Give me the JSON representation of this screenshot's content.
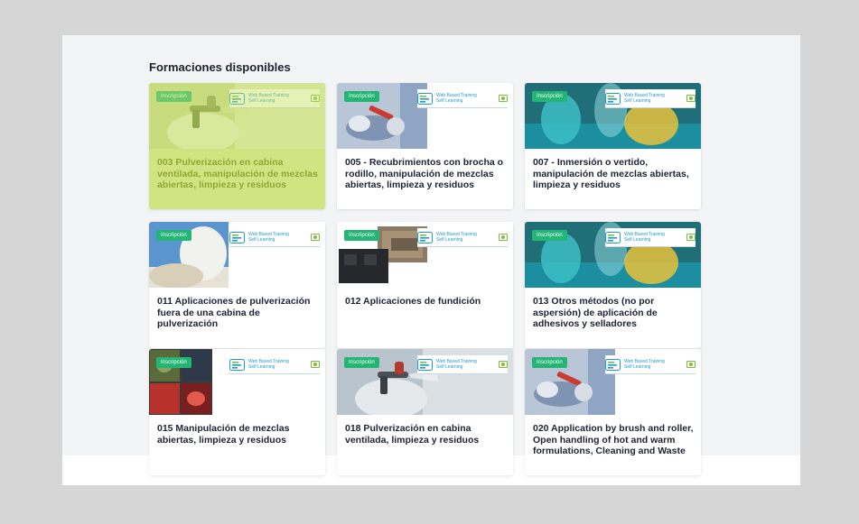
{
  "page": {
    "title": "Formaciones disponibles"
  },
  "badge_label": "Inscripción",
  "brand": {
    "line1": "Web Based Training",
    "line2": "Self Learning"
  },
  "courses": [
    {
      "title": "003 Pulverización en cabina ventilada, manipulación de mezclas abiertas, limpieza y residuos",
      "selected": true
    },
    {
      "title": "005 - Recubrimientos con brocha o rodillo, manipulación de mezclas abiertas, limpieza y residuos"
    },
    {
      "title": "007 - Inmersión o vertido, manipulación de mezclas abiertas, limpieza y residuos"
    },
    {
      "title": "011 Aplicaciones de pulverización fuera de una cabina de pulverización"
    },
    {
      "title": "012 Aplicaciones de fundición"
    },
    {
      "title": "013 Otros métodos (no por aspersión) de aplicación de adhesivos y selladores"
    },
    {
      "title": "015 Manipulación de mezclas abiertas, limpieza y residuos"
    },
    {
      "title": "018 Pulverización en cabina ventilada, limpieza y residuos"
    },
    {
      "title": "020 Application by brush and roller, Open handling of hot and warm formulations, Cleaning and Waste"
    }
  ],
  "colors": {
    "badge": "#22b573",
    "brand_text": "#1e9ad6",
    "highlight": "#dbe8a0"
  }
}
